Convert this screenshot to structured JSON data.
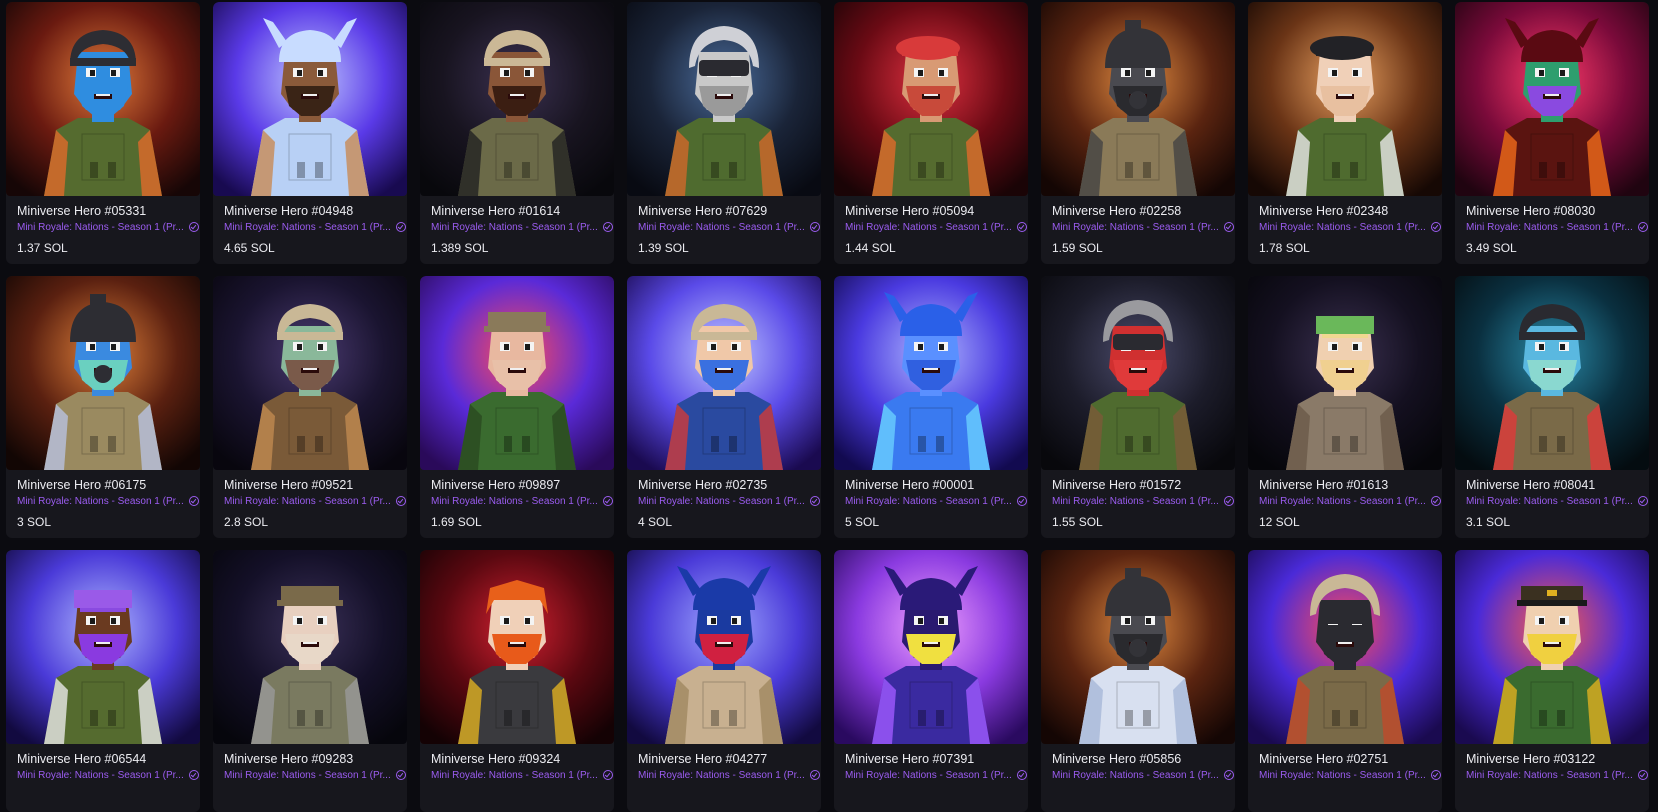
{
  "collection_label": "Mini Royale: Nations - Season 1 (Pr...",
  "cards": [
    {
      "name": "Miniverse Hero #05331",
      "price": "1.37 SOL",
      "bg": [
        "#e07a3a",
        "#6a1a10",
        "#160606"
      ],
      "skin": "#2f8de0",
      "beard": "#2f8de0",
      "hair": "#2a2a2e",
      "hat": "helmet",
      "hatColor": "#2d2d33",
      "outfit": "#556b2f",
      "accent": "#e06a2a"
    },
    {
      "name": "Miniverse Hero #04948",
      "price": "4.65 SOL",
      "bg": [
        "#c0c8ff",
        "#5a3ae8",
        "#180a50"
      ],
      "skin": "#8a5a3a",
      "beard": "#3a2416",
      "hair": "#e8f0ff",
      "hat": "horns",
      "hatColor": "#c8dcff",
      "outfit": "#b8d0f5",
      "accent": "#c88a55"
    },
    {
      "name": "Miniverse Hero #01614",
      "price": "1.389 SOL",
      "bg": [
        "#3a3050",
        "#181420",
        "#08080c"
      ],
      "skin": "#8a5638",
      "beard": "#3b1e12",
      "hair": "#c9b89a",
      "hat": "helmet",
      "hatColor": "#cbb896",
      "outfit": "#6b6a48",
      "accent": "#222"
    },
    {
      "name": "Miniverse Hero #07629",
      "price": "1.39 SOL",
      "bg": [
        "#4a6b9a",
        "#1a2438",
        "#080a12"
      ],
      "skin": "#c9c9c9",
      "beard": "#9a9a9a",
      "hair": "#d8d8dc",
      "hat": "pilot",
      "hatColor": "#cfd0d6",
      "outfit": "#4f6b2f",
      "accent": "#d0682a"
    },
    {
      "name": "Miniverse Hero #05094",
      "price": "1.44 SOL",
      "bg": [
        "#e03040",
        "#6a0a14",
        "#1a0406"
      ],
      "skin": "#d89a74",
      "beard": "#c84a3a",
      "hair": "#d83a3a",
      "hat": "beret",
      "hatColor": "#d83a3a",
      "outfit": "#556b2f",
      "accent": "#e06a2a"
    },
    {
      "name": "Miniverse Hero #02258",
      "price": "1.59 SOL",
      "bg": [
        "#e08a40",
        "#5a2410",
        "#140604"
      ],
      "skin": "#4a4a50",
      "beard": "#2a2a2e",
      "hair": "#2a2a2e",
      "hat": "gasmask",
      "hatColor": "#333338",
      "outfit": "#8a7a58",
      "accent": "#444"
    },
    {
      "name": "Miniverse Hero #02348",
      "price": "1.78 SOL",
      "bg": [
        "#e8a060",
        "#6a3416",
        "#160804"
      ],
      "skin": "#f0d0b8",
      "beard": "#e8c0a0",
      "hair": "#e8d090",
      "hat": "beret",
      "hatColor": "#222226",
      "outfit": "#4f6b2f",
      "accent": "#e8e8e8"
    },
    {
      "name": "Miniverse Hero #08030",
      "price": "3.49 SOL",
      "bg": [
        "#ff3a6a",
        "#7a0a3a",
        "#200410"
      ],
      "skin": "#2e9e6e",
      "beard": "#8a4ae0",
      "hair": "#2a1010",
      "hat": "horns",
      "hatColor": "#5a0a12",
      "outfit": "#5a1410",
      "accent": "#f06a1a"
    },
    {
      "name": "Miniverse Hero #06175",
      "price": "3 SOL",
      "bg": [
        "#e0803a",
        "#5a2010",
        "#120604"
      ],
      "skin": "#3a8ae0",
      "beard": "#6ad0c0",
      "hair": "#2a2a2e",
      "hat": "gasmask",
      "hatColor": "#2d2d33",
      "outfit": "#9a8a60",
      "accent": "#b8c0e0"
    },
    {
      "name": "Miniverse Hero #09521",
      "price": "2.8 SOL",
      "bg": [
        "#4a3a70",
        "#1a1430",
        "#08060e"
      ],
      "skin": "#8ab89a",
      "beard": "#7a5a4a",
      "hair": "#c9b89a",
      "hat": "helmet",
      "hatColor": "#c9b896",
      "outfit": "#7a5a38",
      "accent": "#c08a50"
    },
    {
      "name": "Miniverse Hero #09897",
      "price": "1.69 SOL",
      "bg": [
        "#ff4a5a",
        "#5a2ad8",
        "#2a0a5a"
      ],
      "skin": "#e8b8a0",
      "beard": "#e8c0a8",
      "hair": "#8a7050",
      "hat": "cap",
      "hatColor": "#8a7a5a",
      "outfit": "#3a6b2f",
      "accent": "#2a4a20"
    },
    {
      "name": "Miniverse Hero #02735",
      "price": "4 SOL",
      "bg": [
        "#c0c8ff",
        "#5a4ae8",
        "#1a0a50"
      ],
      "skin": "#f0c8a8",
      "beard": "#3a70e0",
      "hair": "#c9b89a",
      "hat": "helmet",
      "hatColor": "#c9b896",
      "outfit": "#2a4aa0",
      "accent": "#d03a3a"
    },
    {
      "name": "Miniverse Hero #00001",
      "price": "5 SOL",
      "bg": [
        "#b0b8ff",
        "#4a3ae0",
        "#120a50"
      ],
      "skin": "#5a90ff",
      "beard": "#3060e0",
      "hair": "#2a50d0",
      "hat": "horns",
      "hatColor": "#2a60e8",
      "outfit": "#3a7af0",
      "accent": "#6ad0ff"
    },
    {
      "name": "Miniverse Hero #01572",
      "price": "1.55 SOL",
      "bg": [
        "#4a4a6a",
        "#1c1c2a",
        "#08080c"
      ],
      "skin": "#d03030",
      "beard": "#e03a3a",
      "hair": "#2a2a2e",
      "hat": "pilot",
      "hatColor": "#9a9a9e",
      "outfit": "#4f6b2f",
      "accent": "#7a5a38"
    },
    {
      "name": "Miniverse Hero #01613",
      "price": "12 SOL",
      "bg": [
        "#3a3050",
        "#141020",
        "#06060a"
      ],
      "skin": "#f0d0b0",
      "beard": "#f0d090",
      "hair": "#f0d890",
      "hat": "bandana",
      "hatColor": "#6ab85a",
      "outfit": "#8a7a68",
      "accent": "#6a5a48"
    },
    {
      "name": "Miniverse Hero #08041",
      "price": "3.1 SOL",
      "bg": [
        "#2a8aa8",
        "#0a3040",
        "#040c10"
      ],
      "skin": "#5ab8e0",
      "beard": "#8ad8d0",
      "hair": "#222226",
      "hat": "helmet",
      "hatColor": "#2a2a30",
      "outfit": "#7a6a48",
      "accent": "#e03a3a"
    },
    {
      "name": "Miniverse Hero #06544",
      "price": "",
      "bg": [
        "#b0b8ff",
        "#4a3ad8",
        "#120a40"
      ],
      "skin": "#6a3a20",
      "beard": "#8a3ae0",
      "hair": "#8a4ae0",
      "hat": "bandana",
      "hatColor": "#9a5ae8",
      "outfit": "#556b2f",
      "accent": "#e8e8e8"
    },
    {
      "name": "Miniverse Hero #09283",
      "price": "",
      "bg": [
        "#3a3058",
        "#141028",
        "#06060c"
      ],
      "skin": "#e8d0c0",
      "beard": "#e8d8c8",
      "hair": "#7a6040",
      "hat": "cap",
      "hatColor": "#7a6a4a",
      "outfit": "#7a7a60",
      "accent": "#9a9a9a"
    },
    {
      "name": "Miniverse Hero #09324",
      "price": "",
      "bg": [
        "#d02030",
        "#5a0810",
        "#140204"
      ],
      "skin": "#f0d0b8",
      "beard": "#e85a1a",
      "hair": "#e8601a",
      "hat": "hair",
      "hatColor": "#e8601a",
      "outfit": "#3a3a3e",
      "accent": "#e0b020"
    },
    {
      "name": "Miniverse Hero #04277",
      "price": "",
      "bg": [
        "#a0a8ff",
        "#4a3ad8",
        "#120a40"
      ],
      "skin": "#1a3aa0",
      "beard": "#d02040",
      "hair": "#1a3aa0",
      "hat": "horns",
      "hatColor": "#1a3aa8",
      "outfit": "#c8b090",
      "accent": "#a08860"
    },
    {
      "name": "Miniverse Hero #07391",
      "price": "",
      "bg": [
        "#f0a0ff",
        "#8a3ae0",
        "#2a0a60"
      ],
      "skin": "#2a1a70",
      "beard": "#f0e040",
      "hair": "#2a1a70",
      "hat": "horns",
      "hatColor": "#2a1a78",
      "outfit": "#3a2aa0",
      "accent": "#a05aff"
    },
    {
      "name": "Miniverse Hero #05856",
      "price": "",
      "bg": [
        "#e08a40",
        "#5a2410",
        "#140604"
      ],
      "skin": "#4a4a50",
      "beard": "#2a2a2e",
      "hair": "#2a2a2e",
      "hat": "gasmask",
      "hatColor": "#333338",
      "outfit": "#d8e0f0",
      "accent": "#a8b8d8"
    },
    {
      "name": "Miniverse Hero #02751",
      "price": "",
      "bg": [
        "#ff4a5a",
        "#4a2ad8",
        "#1a0a50"
      ],
      "skin": "#2a2a30",
      "beard": "#2a2a30",
      "hair": "#c9b89a",
      "hat": "pilot",
      "hatColor": "#c9b896",
      "outfit": "#7a6a48",
      "accent": "#c04a2a"
    },
    {
      "name": "Miniverse Hero #03122",
      "price": "",
      "bg": [
        "#ff5a4a",
        "#4a2ad8",
        "#1a0a50"
      ],
      "skin": "#f0d0b0",
      "beard": "#f0d040",
      "hair": "#2a2a2e",
      "hat": "officer",
      "hatColor": "#3a3020",
      "outfit": "#3a6b2f",
      "accent": "#e0b020"
    }
  ]
}
